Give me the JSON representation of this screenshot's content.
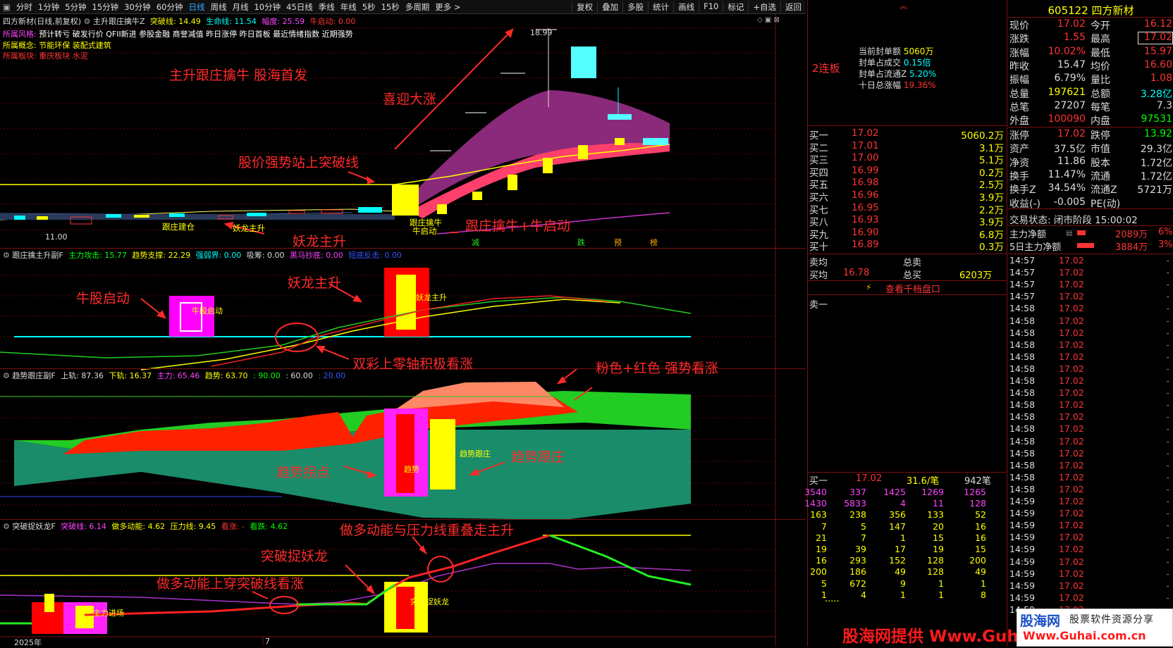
{
  "toolbar": {
    "tabs": [
      "分时",
      "1分钟",
      "5分钟",
      "15分钟",
      "30分钟",
      "60分钟",
      "日线",
      "周线",
      "月线",
      "10分钟",
      "45日线",
      "季线",
      "年线",
      "5秒",
      "15秒",
      "多周期",
      "更多 >"
    ],
    "active": "日线",
    "right_buttons": [
      "复权",
      "叠加",
      "多股",
      "统计",
      "画线",
      "F10",
      "标记",
      "+自选",
      "返回"
    ]
  },
  "main_panel": {
    "stock_label": "四方新材(日线,前复权)",
    "indicator": "主升跟庄擒牛Z",
    "values": [
      {
        "label": "突破线: 14.49",
        "color": "#ffff00"
      },
      {
        "label": "生命线: 11.54",
        "color": "#00ffff"
      },
      {
        "label": "幅度: 25.59",
        "color": "#ff44ff"
      },
      {
        "label": "牛启动: 0.00",
        "color": "#ff3333"
      }
    ],
    "style_label": "所属风格:",
    "style_value": "预计转亏 破发行价 QFII新进 参股金融 商誉减值 昨日涨停 昨日首板 最近情绪指数 近期强势",
    "concept_label": "所属概念:",
    "concept_value": "节能环保 装配式建筑",
    "sector_label": "所属板块:",
    "sector_value": "重庆板块  水泥",
    "y_ticks": [
      "19.00",
      "18.00",
      "17.00",
      "16.00",
      "15.00",
      "14.00",
      "13.00",
      "12.00",
      "11.00"
    ],
    "high_label": "18.99",
    "low_label": "11.00",
    "markers": [
      "跟庄建仓",
      "妖龙主升",
      "跟庄擒牛",
      "牛启动",
      "减",
      "跌",
      "预",
      "榜"
    ],
    "annotations": [
      "主升跟庄擒牛 股海首发",
      "喜迎大涨",
      "股价强势站上突破线",
      "跟庄擒牛+牛启动",
      "妖龙主升"
    ]
  },
  "panel2": {
    "indicator": "跟庄擒主升副F",
    "values": [
      {
        "label": "主力攻击: 15.77",
        "color": "#00ff00"
      },
      {
        "label": "趋势支撑: 22.29",
        "color": "#ffff00"
      },
      {
        "label": "强弱界: 0.00",
        "color": "#00ffff"
      },
      {
        "label": "吸筹: 0.00",
        "color": "#dddddd"
      },
      {
        "label": "黑马抄底: 0.00",
        "color": "#ff44ff"
      },
      {
        "label": "短底反击: 0.00",
        "color": "#3355ff"
      }
    ],
    "y_ticks": [
      "45.00",
      "30.00",
      "15.00",
      "0.00"
    ],
    "markers": [
      "牛股启动",
      "妖龙主升"
    ],
    "annotations": [
      "牛股启动",
      "妖龙主升",
      "双彩上零轴积极看涨"
    ]
  },
  "panel3": {
    "indicator": "趋势跟庄副F",
    "values": [
      {
        "label": "上轨: 87.36",
        "color": "#dddddd"
      },
      {
        "label": "下轨: 16.37",
        "color": "#ffff00"
      },
      {
        "label": "主力: 65.46",
        "color": "#ff44ff"
      },
      {
        "label": "趋势: 63.70",
        "color": "#ffff00"
      },
      {
        "label": ": 90.00",
        "color": "#00ff00"
      },
      {
        "label": ": 60.00",
        "color": "#dddddd"
      },
      {
        "label": ": 20.00",
        "color": "#3355ff"
      }
    ],
    "y_ticks": [
      "90.00",
      "75.00",
      "60.00",
      "45.00",
      "30.00",
      "15.00"
    ],
    "markers": [
      "趋势",
      "趋势跟庄"
    ],
    "annotations": [
      "粉色+红色 强势看涨",
      "趋势拐点",
      "趋势跟庄"
    ]
  },
  "panel4": {
    "indicator": "突破捉妖龙F",
    "values": [
      {
        "label": "突破线: 6.14",
        "color": "#ff44ff"
      },
      {
        "label": "做多动能: 4.62",
        "color": "#ffff00"
      },
      {
        "label": "压力线: 9.45",
        "color": "#ffff00"
      },
      {
        "label": "看涨: -",
        "color": "#ff3333"
      },
      {
        "label": "看跌: 4.62",
        "color": "#00ff00"
      }
    ],
    "y_ticks": [
      "8.00",
      "6.00",
      "4.00",
      "2.00"
    ],
    "markers": [
      "主力进场",
      "突破捉妖龙"
    ],
    "annotations": [
      "做多动能与压力线重叠走主升",
      "突破捉妖龙",
      "做多动能上穿突破线看涨"
    ],
    "x_labels": [
      "2025年",
      "7"
    ],
    "period": "日线"
  },
  "right_mid": {
    "lianban": "2连板",
    "seal_rows": [
      {
        "label": "当前封单额",
        "value": "5060万",
        "color": "#ffff00"
      },
      {
        "label": "封单占成交",
        "value": "0.15倍",
        "color": "#00ffff"
      },
      {
        "label": "封单占流通Z",
        "value": "5.20%",
        "color": "#00ffff"
      },
      {
        "label": "十日总涨幅",
        "value": "19.36%",
        "color": "#ff3333"
      }
    ],
    "buy_rows": [
      {
        "label": "买一",
        "price": "17.02",
        "vol": "5060.2万"
      },
      {
        "label": "买二",
        "price": "17.01",
        "vol": "3.1万"
      },
      {
        "label": "买三",
        "price": "17.00",
        "vol": "5.1万"
      },
      {
        "label": "买四",
        "price": "16.99",
        "vol": "0.2万"
      },
      {
        "label": "买五",
        "price": "16.98",
        "vol": "2.5万"
      },
      {
        "label": "买六",
        "price": "16.96",
        "vol": "3.9万"
      },
      {
        "label": "买七",
        "price": "16.95",
        "vol": "2.2万"
      },
      {
        "label": "买八",
        "price": "16.93",
        "vol": "3.9万"
      },
      {
        "label": "买九",
        "price": "16.90",
        "vol": "6.8万"
      },
      {
        "label": "买十",
        "price": "16.89",
        "vol": "0.3万"
      }
    ],
    "avg_sell_label": "卖均",
    "total_sell_label": "总卖",
    "avg_buy_label": "买均",
    "avg_buy_value": "16.78",
    "total_buy_label": "总买",
    "total_buy_value": "6203万",
    "thousand_link": "查看千档盘口",
    "sell_one": "卖一",
    "queue_header": {
      "label": "买一",
      "price": "17.02",
      "per": "31.6/笔",
      "count": "942笔"
    },
    "queue": [
      [
        "3540",
        "337",
        "1425",
        "1269",
        "1265"
      ],
      [
        "1430",
        "5833",
        "4",
        "11",
        "128"
      ],
      [
        "163",
        "238",
        "356",
        "133",
        "52"
      ],
      [
        "7",
        "5",
        "147",
        "20",
        "16"
      ],
      [
        "21",
        "7",
        "1",
        "15",
        "16"
      ],
      [
        "19",
        "39",
        "17",
        "19",
        "15"
      ],
      [
        "16",
        "293",
        "152",
        "128",
        "200"
      ],
      [
        "200",
        "186",
        "49",
        "128",
        "49"
      ],
      [
        "5",
        "672",
        "9",
        "1",
        "1"
      ],
      [
        "1",
        "4",
        "1",
        "1",
        "8"
      ]
    ],
    "queue_more": "....."
  },
  "quote": {
    "code_name": "605122 四方新材",
    "rows": [
      {
        "l1": "现价",
        "v1": "17.02",
        "c1": "#ff3333",
        "l2": "今开",
        "v2": "16.12",
        "c2": "#ff3333"
      },
      {
        "l1": "涨跌",
        "v1": "1.55",
        "c1": "#ff3333",
        "l2": "最高",
        "v2": "17.02",
        "c2": "#ff3333"
      },
      {
        "l1": "涨幅",
        "v1": "10.02%",
        "c1": "#ff3333",
        "l2": "最低",
        "v2": "15.97",
        "c2": "#ff3333"
      },
      {
        "l1": "昨收",
        "v1": "15.47",
        "c1": "#dddddd",
        "l2": "均价",
        "v2": "16.60",
        "c2": "#ff3333"
      },
      {
        "l1": "振幅",
        "v1": "6.79%",
        "c1": "#dddddd",
        "l2": "量比",
        "v2": "1.08",
        "c2": "#ff3333"
      },
      {
        "l1": "总量",
        "v1": "197621",
        "c1": "#ffff00",
        "l2": "总额",
        "v2": "3.28亿",
        "c2": "#00ffff"
      },
      {
        "l1": "总笔",
        "v1": "27207",
        "c1": "#dddddd",
        "l2": "每笔",
        "v2": "7.3",
        "c2": "#dddddd"
      },
      {
        "l1": "外盘",
        "v1": "100090",
        "c1": "#ff3333",
        "l2": "内盘",
        "v2": "97531",
        "c2": "#00ff00"
      }
    ],
    "rows2": [
      {
        "l1": "涨停",
        "v1": "17.02",
        "c1": "#ff3333",
        "l2": "跌停",
        "v2": "13.92",
        "c2": "#00ff00"
      },
      {
        "l1": "资产",
        "v1": "37.5亿",
        "c1": "#dddddd",
        "l2": "市值",
        "v2": "29.3亿",
        "c2": "#dddddd"
      },
      {
        "l1": "净资",
        "v1": "11.86",
        "c1": "#dddddd",
        "l2": "股本",
        "v2": "1.72亿",
        "c2": "#dddddd"
      },
      {
        "l1": "换手",
        "v1": "11.47%",
        "c1": "#dddddd",
        "l2": "流通",
        "v2": "1.72亿",
        "c2": "#dddddd"
      },
      {
        "l1": "换手Z",
        "v1": "34.54%",
        "c1": "#dddddd",
        "l2": "流通Z",
        "v2": "5721万",
        "c2": "#dddddd"
      },
      {
        "l1": "收益(-)",
        "v1": "-0.005",
        "c1": "#dddddd",
        "l2": "PE(动)",
        "v2": "",
        "c2": "#dddddd"
      }
    ],
    "status": "交易状态: 闭市阶段 15:00:02",
    "main_net_label": "主力净额",
    "main_net_value": "2089万",
    "main_net_pct": "6%",
    "main5_label": "5日主力净额",
    "main5_value": "3884万",
    "main5_pct": "3%"
  },
  "ticks": [
    {
      "t": "14:57",
      "p": "17.02"
    },
    {
      "t": "14:57",
      "p": "17.02"
    },
    {
      "t": "14:57",
      "p": "17.02"
    },
    {
      "t": "14:57",
      "p": "17.02"
    },
    {
      "t": "14:58",
      "p": "17.02"
    },
    {
      "t": "14:58",
      "p": "17.02"
    },
    {
      "t": "14:58",
      "p": "17.02"
    },
    {
      "t": "14:58",
      "p": "17.02"
    },
    {
      "t": "14:58",
      "p": "17.02"
    },
    {
      "t": "14:58",
      "p": "17.02"
    },
    {
      "t": "14:58",
      "p": "17.02"
    },
    {
      "t": "14:58",
      "p": "17.02"
    },
    {
      "t": "14:58",
      "p": "17.02"
    },
    {
      "t": "14:58",
      "p": "17.02"
    },
    {
      "t": "14:58",
      "p": "17.02"
    },
    {
      "t": "14:58",
      "p": "17.02"
    },
    {
      "t": "14:58",
      "p": "17.02"
    },
    {
      "t": "14:58",
      "p": "17.02"
    },
    {
      "t": "14:58",
      "p": "17.02"
    },
    {
      "t": "14:58",
      "p": "17.02"
    },
    {
      "t": "14:59",
      "p": "17.02"
    },
    {
      "t": "14:59",
      "p": "17.02"
    },
    {
      "t": "14:59",
      "p": "17.02"
    },
    {
      "t": "14:59",
      "p": "17.02"
    },
    {
      "t": "14:59",
      "p": "17.02"
    },
    {
      "t": "14:59",
      "p": "17.02"
    },
    {
      "t": "14:59",
      "p": "17.02"
    },
    {
      "t": "14:59",
      "p": "17.02"
    },
    {
      "t": "14:59",
      "p": "17.02"
    },
    {
      "t": "14:59",
      "p": "17.02"
    }
  ],
  "watermark": {
    "left": "股海网提供 Www.Guhai.com.cn",
    "logo": "股海网",
    "logo_sub": "股票软件资源分享",
    "logo_url": "Www.Guhai.com.cn"
  }
}
